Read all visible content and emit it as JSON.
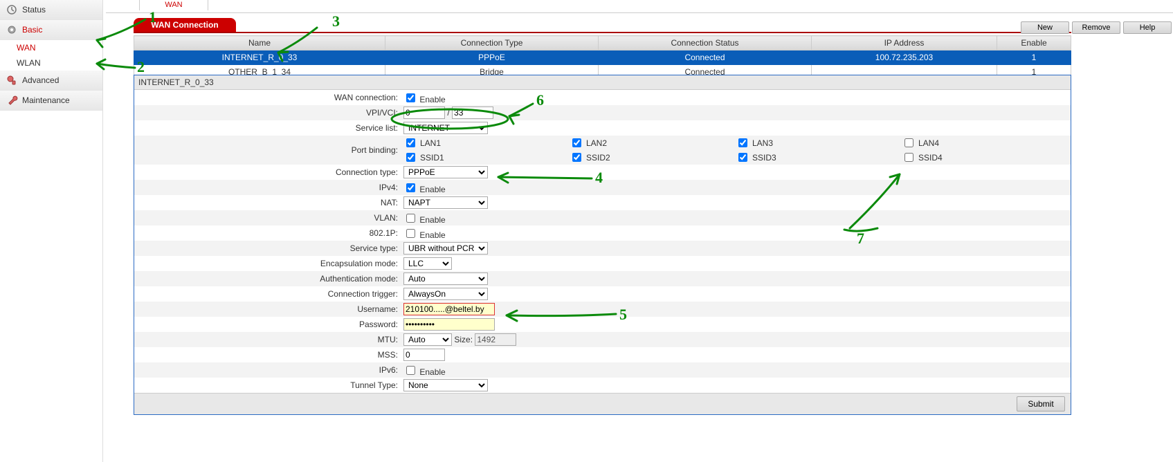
{
  "sidebar": {
    "items": [
      {
        "label": "Status",
        "icon": "status-icon"
      },
      {
        "label": "Basic",
        "icon": "gear-icon",
        "active": true,
        "children": [
          {
            "label": "WAN",
            "active": true
          },
          {
            "label": "WLAN"
          }
        ]
      },
      {
        "label": "Advanced",
        "icon": "advanced-icon"
      },
      {
        "label": "Maintenance",
        "icon": "maintenance-icon"
      }
    ]
  },
  "toptab": {
    "label": "WAN"
  },
  "section": {
    "title": "WAN Connection"
  },
  "actions": {
    "new": "New",
    "remove": "Remove",
    "help": "Help"
  },
  "table": {
    "cols": [
      "Name",
      "Connection Type",
      "Connection Status",
      "IP Address",
      "Enable"
    ],
    "rows": [
      {
        "sel": true,
        "cells": [
          "INTERNET_R_0_33",
          "PPPoE",
          "Connected",
          "100.72.235.203",
          "1"
        ]
      },
      {
        "sel": false,
        "cells": [
          "OTHER_B_1_34",
          "Bridge",
          "Connected",
          "",
          "1"
        ]
      }
    ]
  },
  "detail": {
    "title": "INTERNET_R_0_33",
    "wan_conn_label": "WAN connection:",
    "wan_conn_enable": "Enable",
    "wan_conn_checked": true,
    "vpi_label": "VPI/VCI:",
    "vpi": "0",
    "vci": "33",
    "slash": "/",
    "service_list_label": "Service list:",
    "service_list": "INTERNET",
    "port_label": "Port binding:",
    "ports": [
      {
        "name": "LAN1",
        "checked": true
      },
      {
        "name": "LAN2",
        "checked": true
      },
      {
        "name": "LAN3",
        "checked": true
      },
      {
        "name": "LAN4",
        "checked": false
      },
      {
        "name": "SSID1",
        "checked": true
      },
      {
        "name": "SSID2",
        "checked": true
      },
      {
        "name": "SSID3",
        "checked": true
      },
      {
        "name": "SSID4",
        "checked": false
      }
    ],
    "conn_type_label": "Connection type:",
    "conn_type": "PPPoE",
    "ipv4_label": "IPv4:",
    "ipv4_enable": "Enable",
    "ipv4_checked": true,
    "nat_label": "NAT:",
    "nat": "NAPT",
    "vlan_label": "VLAN:",
    "vlan_enable": "Enable",
    "vlan_checked": false,
    "p8021_label": "802.1P:",
    "p8021_enable": "Enable",
    "p8021_checked": false,
    "service_type_label": "Service type:",
    "service_type": "UBR without PCR",
    "encap_label": "Encapsulation mode:",
    "encap": "LLC",
    "auth_label": "Authentication mode:",
    "auth": "Auto",
    "trigger_label": "Connection trigger:",
    "trigger": "AlwaysOn",
    "user_label": "Username:",
    "username": "210100.....@beltel.by",
    "pass_label": "Password:",
    "password": "••••••••••",
    "mtu_label": "MTU:",
    "mtu_mode": "Auto",
    "mtu_size_label": "Size:",
    "mtu_size": "1492",
    "mss_label": "MSS:",
    "mss": "0",
    "ipv6_label": "IPv6:",
    "ipv6_enable": "Enable",
    "ipv6_checked": false,
    "tunnel_label": "Tunnel Type:",
    "tunnel": "None",
    "submit": "Submit"
  },
  "annotations": [
    "1",
    "2",
    "3",
    "4",
    "5",
    "6",
    "7"
  ]
}
